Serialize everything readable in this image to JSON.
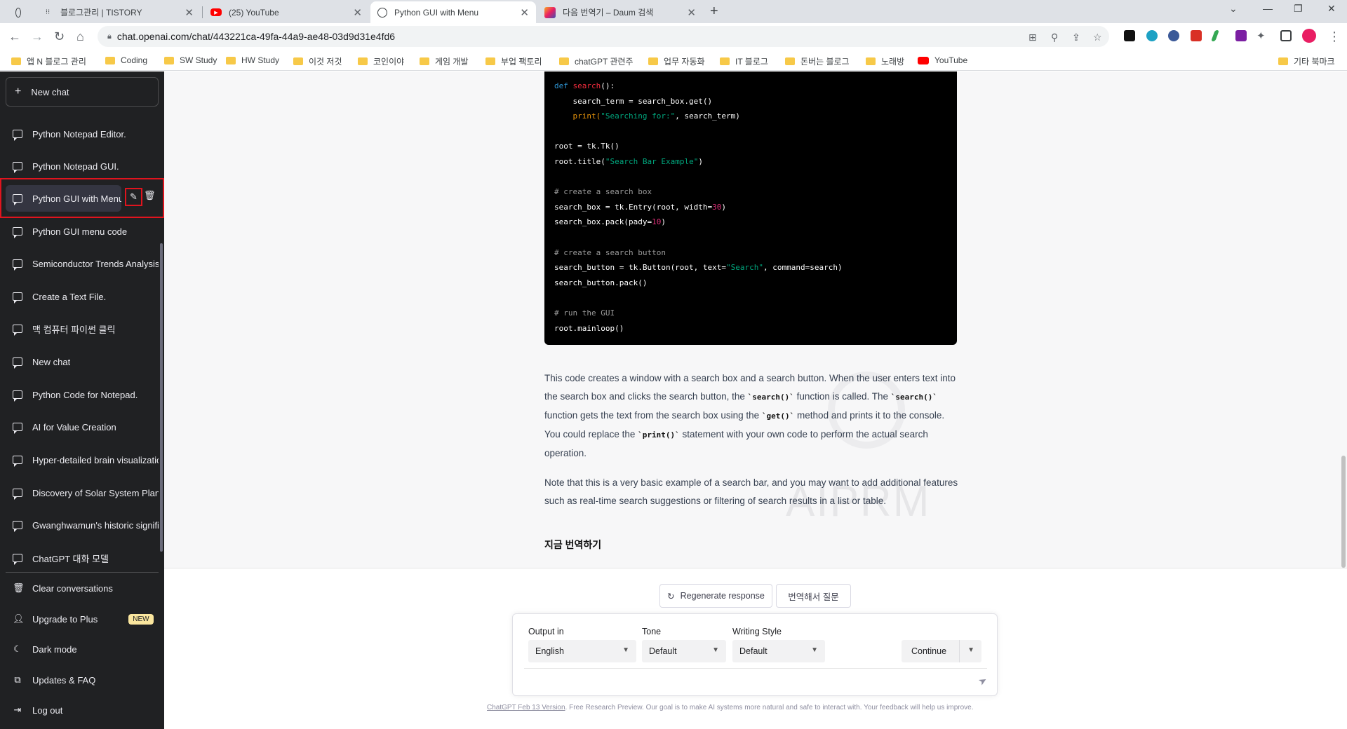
{
  "browser": {
    "tabs": [
      {
        "label": "",
        "icon": "openai-icon"
      },
      {
        "label": "블로그관리 | TISTORY",
        "icon": "tistory-icon"
      },
      {
        "label": "(25) YouTube",
        "icon": "youtube-icon"
      },
      {
        "label": "Python GUI with Menu",
        "icon": "openai-icon",
        "active": true
      },
      {
        "label": "다음 번역기 – Daum 검색",
        "icon": "daum-icon"
      }
    ],
    "url": "chat.openai.com/chat/443221ca-49fa-44a9-ae48-03d9d31e4fd6",
    "bookmarks": [
      "앱 N 블로그 관리",
      "Coding",
      "SW Study",
      "HW Study",
      "이것 저것",
      "코인이야",
      "게임 개발",
      "부업 팩토리",
      "chatGPT 관련주",
      "업무 자동화",
      "IT 블로그",
      "돈버는 블로그",
      "노래방",
      "YouTube"
    ],
    "other_bookmarks": "기타 북마크"
  },
  "sidebar": {
    "new_chat": "New chat",
    "conversations": [
      "Python Notepad Editor.",
      "Python Notepad GUI.",
      "Python GUI with Menu",
      "Python GUI menu code",
      "Semiconductor Trends Analysis",
      "Create a Text File.",
      "맥 컴퓨터 파이썬 클릭",
      "New chat",
      "Python Code for Notepad.",
      "AI for Value Creation",
      "Hyper-detailed brain visualization",
      "Discovery of Solar System Planets",
      "Gwanghwamun's historic significance",
      "ChatGPT 대화 모델"
    ],
    "bottom": {
      "clear": "Clear conversations",
      "upgrade": "Upgrade to Plus",
      "new_badge": "NEW",
      "dark_mode": "Dark mode",
      "updates": "Updates & FAQ",
      "logout": "Log out"
    }
  },
  "code": {
    "l1_kw": "def",
    "l1_fn": "search",
    "l1_rest": "():",
    "l2": "    search_term = search_box.get()",
    "l3_a": "    print(",
    "l3_str": "\"Searching for:\"",
    "l3_b": ", search_term)",
    "l4": "root = tk.Tk()",
    "l5_a": "root.title(",
    "l5_str": "\"Search Bar Example\"",
    "l5_b": ")",
    "l6": "# create a search box",
    "l7_a": "search_box = tk.Entry(root, width=",
    "l7_num": "30",
    "l7_b": ")",
    "l8_a": "search_box.pack(pady=",
    "l8_num": "10",
    "l8_b": ")",
    "l9": "# create a search button",
    "l10_a": "search_button = tk.Button(root, text=",
    "l10_str": "\"Search\"",
    "l10_b": ", command=search)",
    "l11": "search_button.pack()",
    "l12": "# run the GUI",
    "l13": "root.mainloop()"
  },
  "answer": {
    "p1_a": "This code creates a window with a search box and a search button. When the user enters text into the search box and clicks the search button, the ",
    "p1_code1": "`search()`",
    "p1_b": " function is called. The ",
    "p1_code2": "`search()`",
    "p1_c": " function gets the text from the search box using the ",
    "p1_code3": "`get()`",
    "p1_d": " method and prints it to the console. You could replace the ",
    "p1_code4": "`print()`",
    "p1_e": " statement with your own code to perform the actual search operation.",
    "p2": "Note that this is a very basic example of a search bar, and you may want to add additional features such as real-time search suggestions or filtering of search results in a list or table.",
    "translate_now": "지금 번역하기",
    "watermark": "AIPRM"
  },
  "actions": {
    "regenerate": "Regenerate response",
    "translate_ask": "번역해서 질문"
  },
  "composer": {
    "output_label": "Output in",
    "output_value": "English",
    "tone_label": "Tone",
    "tone_value": "Default",
    "style_label": "Writing Style",
    "style_value": "Default",
    "continue": "Continue",
    "placeholder": ""
  },
  "footer": {
    "version_link": "ChatGPT Feb 13 Version",
    "text": ". Free Research Preview. Our goal is to make AI systems more natural and safe to interact with. Your feedback will help us improve."
  }
}
